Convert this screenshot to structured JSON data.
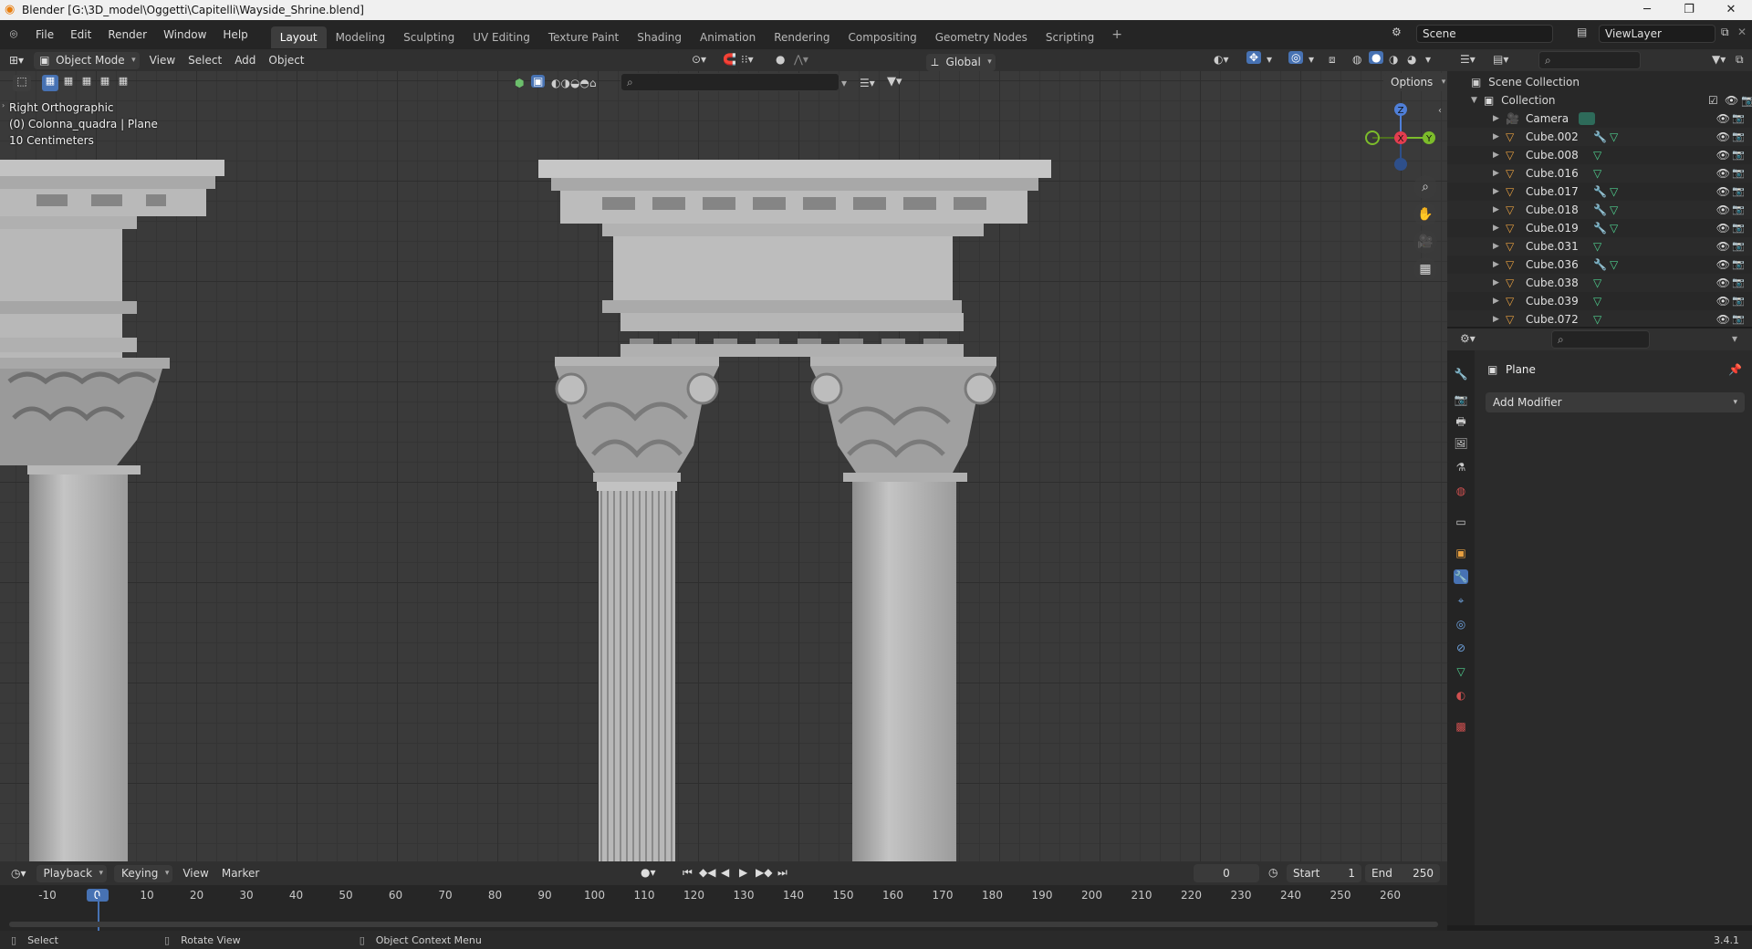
{
  "window": {
    "title": "Blender [G:\\3D_model\\Oggetti\\Capitelli\\Wayside_Shrine.blend]"
  },
  "menu": [
    "File",
    "Edit",
    "Render",
    "Window",
    "Help"
  ],
  "workspaces": [
    "Layout",
    "Modeling",
    "Sculpting",
    "UV Editing",
    "Texture Paint",
    "Shading",
    "Animation",
    "Rendering",
    "Compositing",
    "Geometry Nodes",
    "Scripting"
  ],
  "scene": {
    "label": "Scene",
    "view_layer": "ViewLayer"
  },
  "viewport_header": {
    "mode": "Object Mode",
    "menus": [
      "View",
      "Select",
      "Add",
      "Object"
    ],
    "orientation": "Global",
    "options": "Options"
  },
  "viewport_overlay": {
    "view_name": "Right Orthographic",
    "object_info": "(0) Colonna_quadra | Plane",
    "scale": "10 Centimeters",
    "gizmo": {
      "z": "Z",
      "y": "Y",
      "x": "X"
    }
  },
  "outliner": {
    "root": "Scene Collection",
    "collection": "Collection",
    "items": [
      {
        "name": "Camera",
        "type": "camera"
      },
      {
        "name": "Cube.002",
        "mod": true
      },
      {
        "name": "Cube.008",
        "mod": false
      },
      {
        "name": "Cube.016",
        "mod": false
      },
      {
        "name": "Cube.017",
        "mod": true
      },
      {
        "name": "Cube.018",
        "mod": true
      },
      {
        "name": "Cube.019",
        "mod": true
      },
      {
        "name": "Cube.031",
        "mod": false
      },
      {
        "name": "Cube.036",
        "mod": true
      },
      {
        "name": "Cube.038",
        "mod": false
      },
      {
        "name": "Cube.039",
        "mod": false
      },
      {
        "name": "Cube.072",
        "mod": false
      }
    ]
  },
  "properties": {
    "object_name": "Plane",
    "add_modifier": "Add Modifier"
  },
  "timeline": {
    "menus": [
      "Playback",
      "Keying",
      "View",
      "Marker"
    ],
    "current_frame": "0",
    "start_label": "Start",
    "start": "1",
    "end_label": "End",
    "end": "250",
    "ticks": [
      "-10",
      "0",
      "10",
      "20",
      "30",
      "40",
      "50",
      "60",
      "70",
      "80",
      "90",
      "100",
      "110",
      "120",
      "130",
      "140",
      "150",
      "160",
      "170",
      "180",
      "190",
      "200",
      "210",
      "220",
      "230",
      "240",
      "250",
      "260"
    ]
  },
  "statusbar": {
    "select": "Select",
    "rotate": "Rotate View",
    "context": "Object Context Menu",
    "version": "3.4.1"
  },
  "colors": {
    "accent": "#4772b3",
    "mesh_icon": "#e8a040",
    "modifier_icon": "#5e9bd8",
    "data_icon": "#4fd08f"
  }
}
